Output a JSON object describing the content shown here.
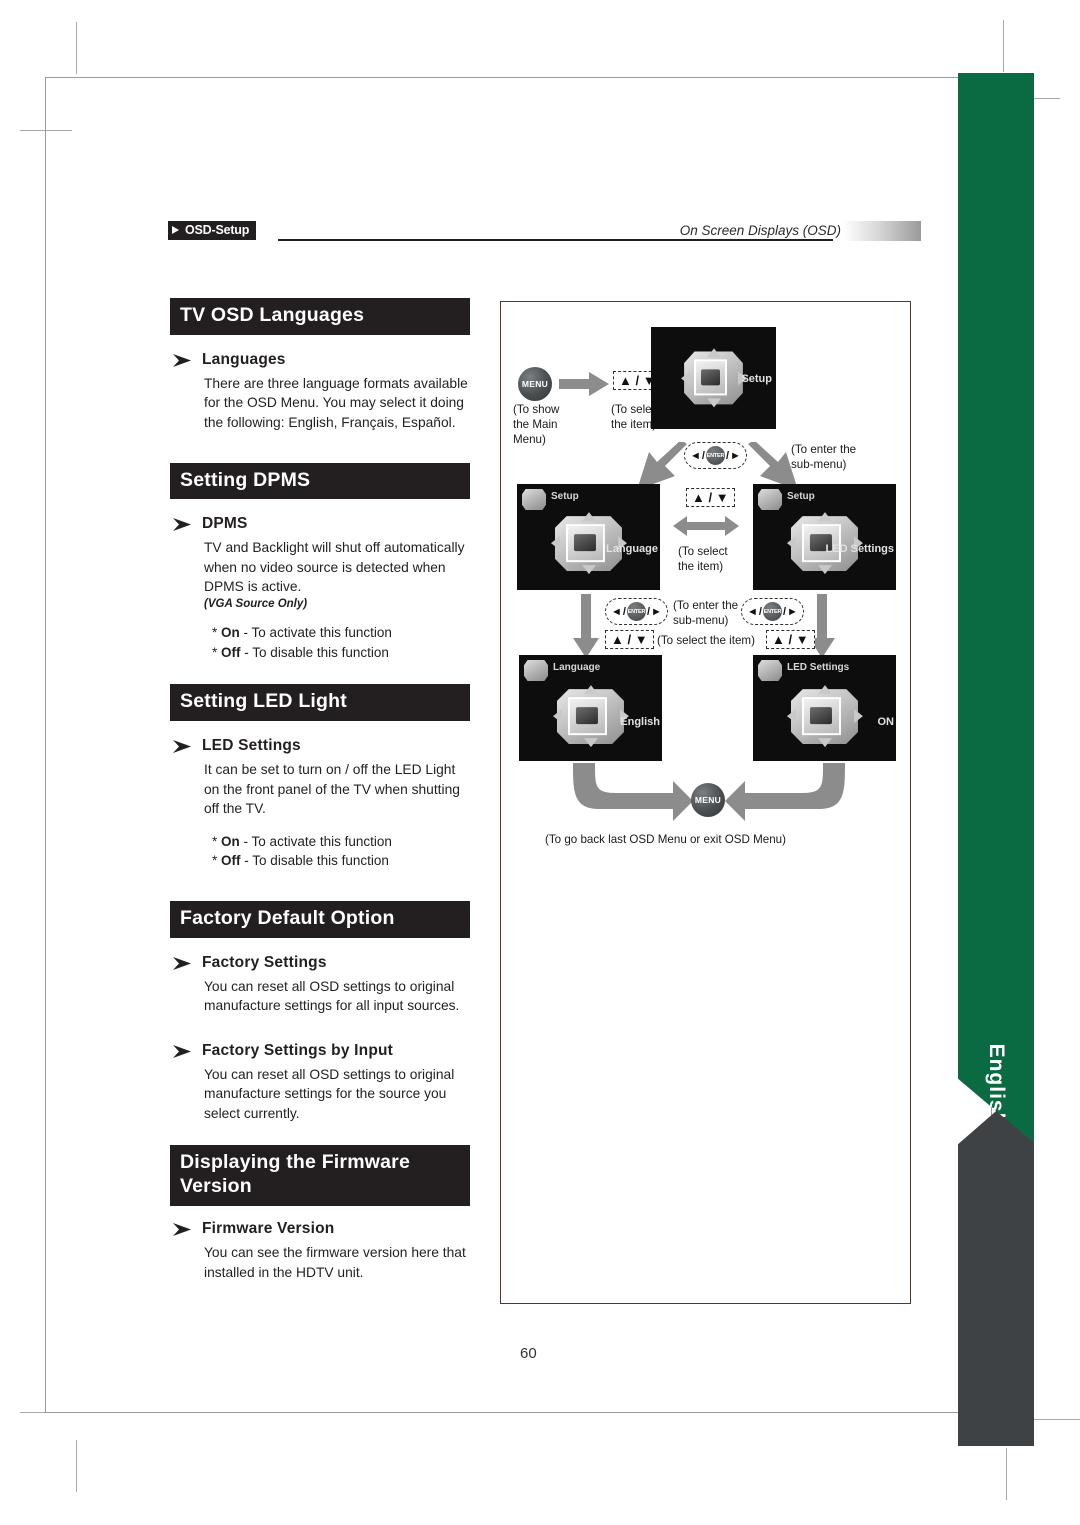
{
  "header": {
    "tag": "OSD-Setup",
    "right_title": "On Screen Displays (OSD)"
  },
  "page_number": "60",
  "language_tab": {
    "label": "English"
  },
  "sections": [
    {
      "heading": "TV OSD Languages",
      "subsections": [
        {
          "title": "Languages",
          "body": "There are three language formats available for the OSD Menu. You may select it doing the following: English, Français, Español.",
          "note": "",
          "options": []
        }
      ]
    },
    {
      "heading": "Setting DPMS",
      "subsections": [
        {
          "title": "DPMS",
          "body": "TV and Backlight will shut off automatically when no video source is detected when DPMS is active.",
          "note": "(VGA Source Only)",
          "options": [
            {
              "marker": "*",
              "key": "On",
              "text": "- To activate this function"
            },
            {
              "marker": "*",
              "key": "Off",
              "text": "- To disable this function"
            }
          ]
        }
      ]
    },
    {
      "heading": "Setting LED Light",
      "subsections": [
        {
          "title": "LED Settings",
          "body": "It can be set to turn on / off the LED Light on the front panel of the TV when shutting off the TV.",
          "note": "",
          "options": [
            {
              "marker": "*",
              "key": "On",
              "text": "- To activate this function"
            },
            {
              "marker": "*",
              "key": "Off",
              "text": "- To disable this function"
            }
          ]
        }
      ]
    },
    {
      "heading": "Factory Default Option",
      "subsections": [
        {
          "title": "Factory Settings",
          "body": "You can reset all OSD settings to original manufacture settings for all input sources.",
          "note": "",
          "options": []
        },
        {
          "title": "Factory Settings by Input",
          "body": "You can reset all OSD settings to original manufacture settings for the source you select currently.",
          "note": "",
          "options": []
        }
      ]
    },
    {
      "heading": "Displaying the Firmware Version",
      "subsections": [
        {
          "title": "Firmware Version",
          "body": "You can see the firmware version here that installed in the HDTV unit.",
          "note": "",
          "options": []
        }
      ]
    }
  ],
  "diagram": {
    "menu_button_label": "MENU",
    "enter_button_label": "ENTER",
    "updown_label": "▲ / ▼",
    "captions": {
      "show_main_menu": "(To show\nthe Main\nMenu)",
      "select_item_1": "(To select\nthe item)",
      "enter_submenu_1": "(To enter the\nsub-menu)",
      "select_item_2": "(To select\nthe item)",
      "enter_submenu_2": "(To enter the\nsub-menu)",
      "select_item_3": "(To select the item)",
      "go_back": "(To go back last OSD Menu or exit OSD Menu)"
    },
    "screens": [
      {
        "id": "setup",
        "label": "Setup"
      },
      {
        "id": "language",
        "label": "Language",
        "corner": "Setup"
      },
      {
        "id": "led-settings",
        "label": "LED Settings",
        "corner": "Setup"
      },
      {
        "id": "english",
        "label": "English",
        "corner": "Language"
      },
      {
        "id": "on",
        "label": "ON",
        "corner": "LED Settings"
      }
    ]
  },
  "colors": {
    "accent_green": "#0a6b43",
    "dark": "#231f20",
    "gray_band": "#3e4245"
  }
}
